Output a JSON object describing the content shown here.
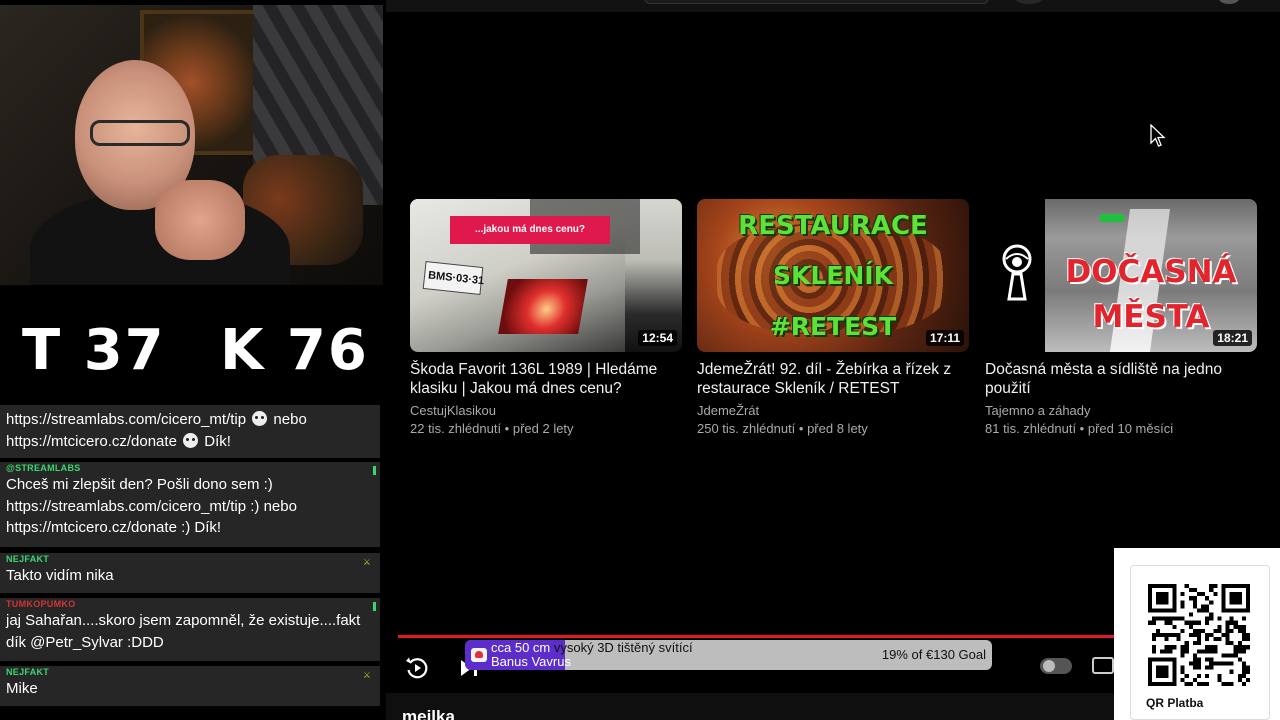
{
  "stream": {
    "scoreboard": {
      "t": "T 37",
      "k": "K 76"
    },
    "chat": [
      {
        "name": "",
        "name_color": "#ffffff",
        "text_before": "https://streamlabs.com/cicero_mt/tip",
        "text_mid": " nebo",
        "text_line2": "https://mtcicero.cz/donate",
        "text_after": " Dík!"
      },
      {
        "name": "@STREAMLABS",
        "name_color": "#3bd671",
        "text": "Chceš mi zlepšit den? Pošli dono sem :) https://streamlabs.com/cicero_mt/tip :) nebo https://mtcicero.cz/donate :) Dík!"
      },
      {
        "name": "NEJFAKT",
        "name_color": "#3bd671",
        "text": "Takto vidím nika"
      },
      {
        "name": "TUMKOPUMKO",
        "name_color": "#d33434",
        "text": "jaj Sahařan....skoro jsem zapomněl, že existuje....fakt dík @Petr_Sylvar :DDD"
      },
      {
        "name": "NEJFAKT",
        "name_color": "#3bd671",
        "text": "Mike"
      }
    ]
  },
  "videos": [
    {
      "title": "Škoda Favorit 136L 1989 | Hledáme klasiku | Jakou má dnes cenu?",
      "channel": "CestujKlasikou",
      "views": "22 tis. zhlédnutí",
      "age": "před 2 lety",
      "duration": "12:54",
      "thumb_banner": "...jakou má dnes cenu?",
      "thumb_plate": "BMS·03·31"
    },
    {
      "title": "JdemeŽrát! 92. díl - Žebírka a řízek z restaurace Skleník / RETEST",
      "channel": "JdemeŽrát",
      "views": "250 tis. zhlédnutí",
      "age": "před 8 lety",
      "duration": "17:11",
      "thumb_line1": "RESTAURACE",
      "thumb_line2": "SKLENÍK",
      "thumb_line3": "#RETEST"
    },
    {
      "title": "Dočasná města a sídliště na jedno použití",
      "channel": "Tajemno a záhady",
      "views": "81 tis. zhlédnutí",
      "age": "před 10 měsíci",
      "duration": "18:21",
      "thumb_line1": "DOČASNÁ",
      "thumb_line2": "MĚSTA"
    }
  ],
  "player": {
    "goal_line1_dark": "cca 50 cm",
    "goal_line1_light": " vysoký 3D tištěný svítící",
    "goal_line2_dark": "Banus Vavrus",
    "goal_progress_text": "19% of €130 Goal",
    "goal_fraction": 0.19,
    "below_title": "mejlka"
  },
  "qr": {
    "label": "QR Platba"
  },
  "colors": {
    "progress": "#e3182a",
    "goal_fill": "#5b2dca",
    "chat_bg": "#262626"
  }
}
